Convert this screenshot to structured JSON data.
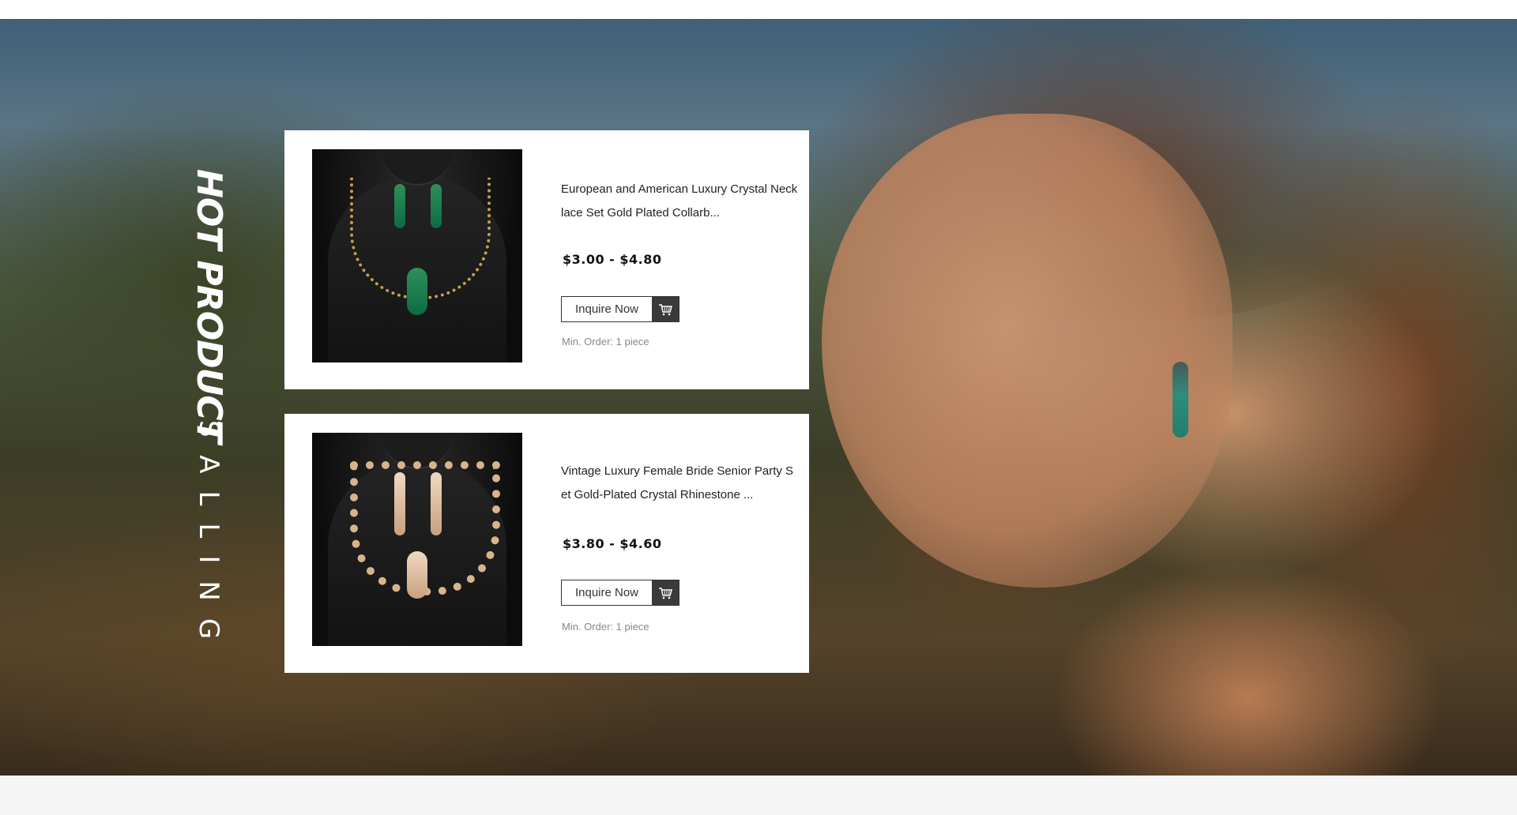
{
  "section": {
    "title_primary": "HOT PRODUCT",
    "title_secondary": "SALLING"
  },
  "products": [
    {
      "title": "European and American Luxury Crystal Necklace Set Gold Plated Collarb...",
      "price": "$3.00 - $4.80",
      "button_label": "Inquire Now",
      "min_order": "Min. Order: 1 piece",
      "image_icon": "emerald-necklace-set-image"
    },
    {
      "title": "Vintage Luxury Female Bride Senior Party Set Gold-Plated Crystal Rhinestone ...",
      "price": "$3.80 - $4.60",
      "button_label": "Inquire Now",
      "min_order": "Min. Order: 1 piece",
      "image_icon": "champagne-crystal-necklace-set-image"
    }
  ],
  "icons": {
    "cart": "shopping-cart-icon"
  },
  "colors": {
    "card_bg": "#ffffff",
    "button_icon_bg": "#3a3a3a",
    "price_text": "#111111",
    "min_order_text": "#888888"
  }
}
